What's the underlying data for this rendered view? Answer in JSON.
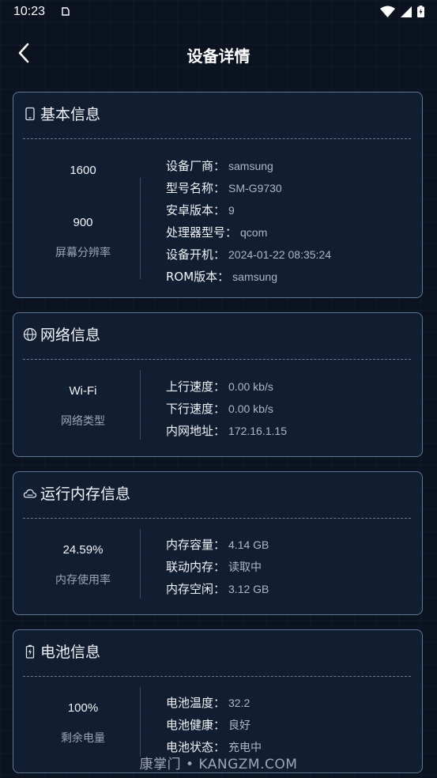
{
  "status_bar": {
    "time": "10:23"
  },
  "header": {
    "title": "设备详情"
  },
  "basic": {
    "title": "基本信息",
    "resolution_width": "1600",
    "resolution_height": "900",
    "resolution_label": "屏幕分辨率",
    "rows": [
      {
        "key": "设备厂商：",
        "value": "samsung"
      },
      {
        "key": "型号名称：",
        "value": "SM-G9730"
      },
      {
        "key": "安卓版本：",
        "value": "9"
      },
      {
        "key": "处理器型号：",
        "value": "qcom"
      },
      {
        "key": "设备开机：",
        "value": "2024-01-22 08:35:24"
      },
      {
        "key": "ROM版本：",
        "value": "samsung"
      }
    ]
  },
  "network": {
    "title": "网络信息",
    "type": "Wi-Fi",
    "type_label": "网络类型",
    "rows": [
      {
        "key": "上行速度：",
        "value": "0.00 kb/s"
      },
      {
        "key": "下行速度：",
        "value": "0.00 kb/s"
      },
      {
        "key": "内网地址：",
        "value": "172.16.1.15"
      }
    ]
  },
  "memory": {
    "title": "运行内存信息",
    "usage": "24.59%",
    "usage_label": "内存使用率",
    "rows": [
      {
        "key": "内存容量：",
        "value": "4.14 GB"
      },
      {
        "key": "联动内存：",
        "value": "读取中"
      },
      {
        "key": "内存空闲：",
        "value": "3.12 GB"
      }
    ]
  },
  "battery": {
    "title": "电池信息",
    "level": "100%",
    "level_label": "剩余电量",
    "rows": [
      {
        "key": "电池温度：",
        "value": "32.2"
      },
      {
        "key": "电池健康：",
        "value": "良好"
      },
      {
        "key": "电池状态：",
        "value": "充电中"
      }
    ]
  },
  "watermark": "康掌门 • KANGZM.COM",
  "colors": {
    "background": "#0b1320",
    "card_border": "#5e7796",
    "card_bg": "#18273e"
  }
}
